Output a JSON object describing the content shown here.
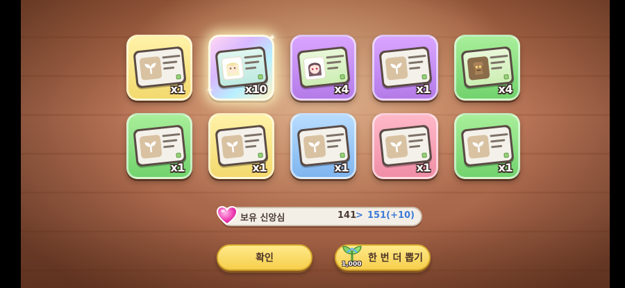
{
  "rewards": [
    {
      "color": "yellow",
      "ticket": "sprout",
      "qty": "x1"
    },
    {
      "color": "special",
      "ticket": "character",
      "qty": "x10"
    },
    {
      "color": "purple",
      "ticket": "character",
      "qty": "x4"
    },
    {
      "color": "purple",
      "ticket": "sprout",
      "qty": "x1"
    },
    {
      "color": "green",
      "ticket": "golem",
      "qty": "x4"
    },
    {
      "color": "green",
      "ticket": "sprout",
      "qty": "x1"
    },
    {
      "color": "yellow",
      "ticket": "sprout",
      "qty": "x1"
    },
    {
      "color": "blue",
      "ticket": "sprout",
      "qty": "x1"
    },
    {
      "color": "pink",
      "ticket": "sprout",
      "qty": "x1"
    },
    {
      "color": "green",
      "ticket": "sprout",
      "qty": "x1"
    }
  ],
  "faith": {
    "icon": "heart-icon",
    "label": "보유 신앙심",
    "old_value": "141",
    "arrow": ">",
    "new_value": "151(+10)",
    "new_value_color": "#3e7bd8"
  },
  "buttons": {
    "confirm_label": "확인",
    "draw_again_label": "한 번 더 뽑기",
    "draw_again_cost": "1,000",
    "draw_again_cost_icon": "sprout-icon"
  }
}
